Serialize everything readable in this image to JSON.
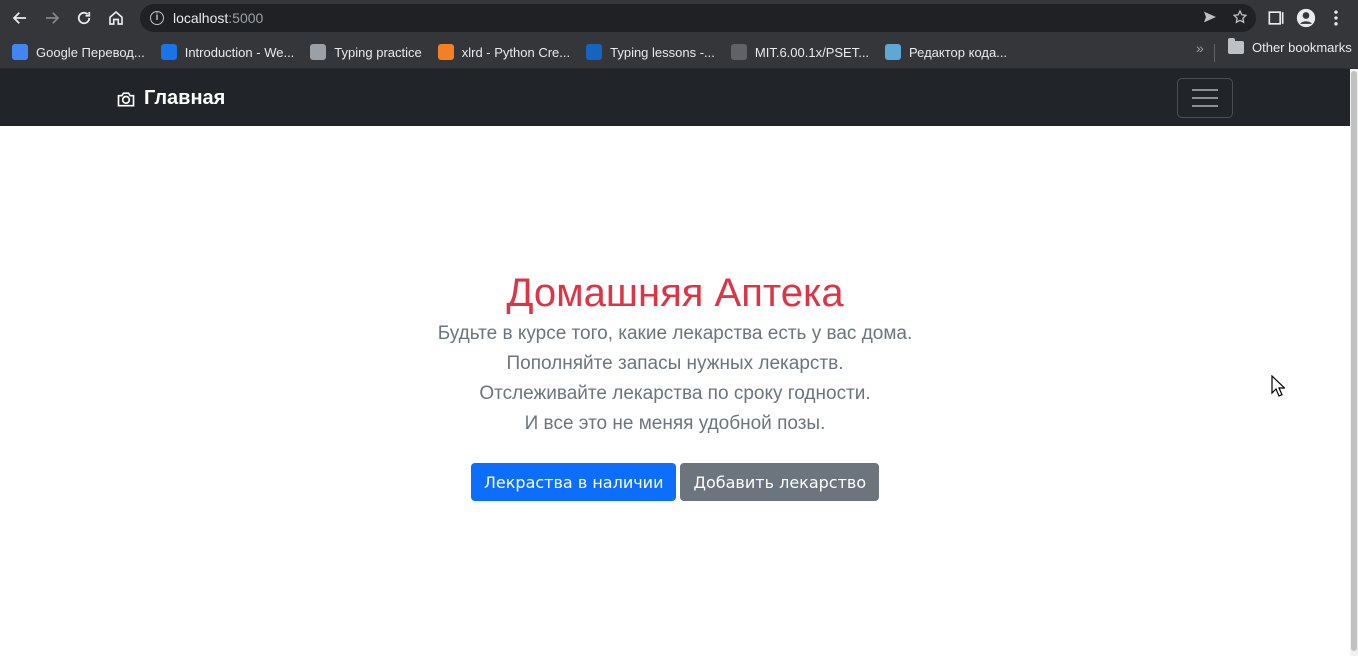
{
  "browser": {
    "url_host": "localhost",
    "url_port": ":5000",
    "bookmarks": [
      {
        "label": "Google Перевод...",
        "icon": "google-translate-icon",
        "color": "#4285f4"
      },
      {
        "label": "Introduction - We...",
        "icon": "infinity-icon",
        "color": "#1a73e8"
      },
      {
        "label": "Typing practice",
        "icon": "keyboard-icon",
        "color": "#9aa0a6"
      },
      {
        "label": "xlrd - Python Cre...",
        "icon": "stackoverflow-icon",
        "color": "#f48024"
      },
      {
        "label": "Typing lessons -...",
        "icon": "typing-lessons-icon",
        "color": "#1565c0"
      },
      {
        "label": "MIT.6.00.1x/PSET...",
        "icon": "github-icon",
        "color": "#5f6368"
      },
      {
        "label": "Редактор кода...",
        "icon": "code-editor-icon",
        "color": "#5fa8d3"
      }
    ],
    "other_bookmarks": "Other bookmarks"
  },
  "navbar": {
    "brand": "Главная",
    "brand_icon": "camera-icon"
  },
  "hero": {
    "title": "Домашняя Аптека",
    "lines": [
      "Будьте в курсе того, какие лекарства есть у вас дома.",
      "Пополняйте запасы нужных лекарств.",
      "Отслеживайте лекарства по сроку годности.",
      "И все это не меняя удобной позы."
    ],
    "primary_button": "Лекраства в наличии",
    "secondary_button": "Добавить лекарство"
  },
  "colors": {
    "title": "#dc3545",
    "primary": "#0d6efd",
    "secondary": "#6c757d",
    "navbar": "#212529"
  }
}
